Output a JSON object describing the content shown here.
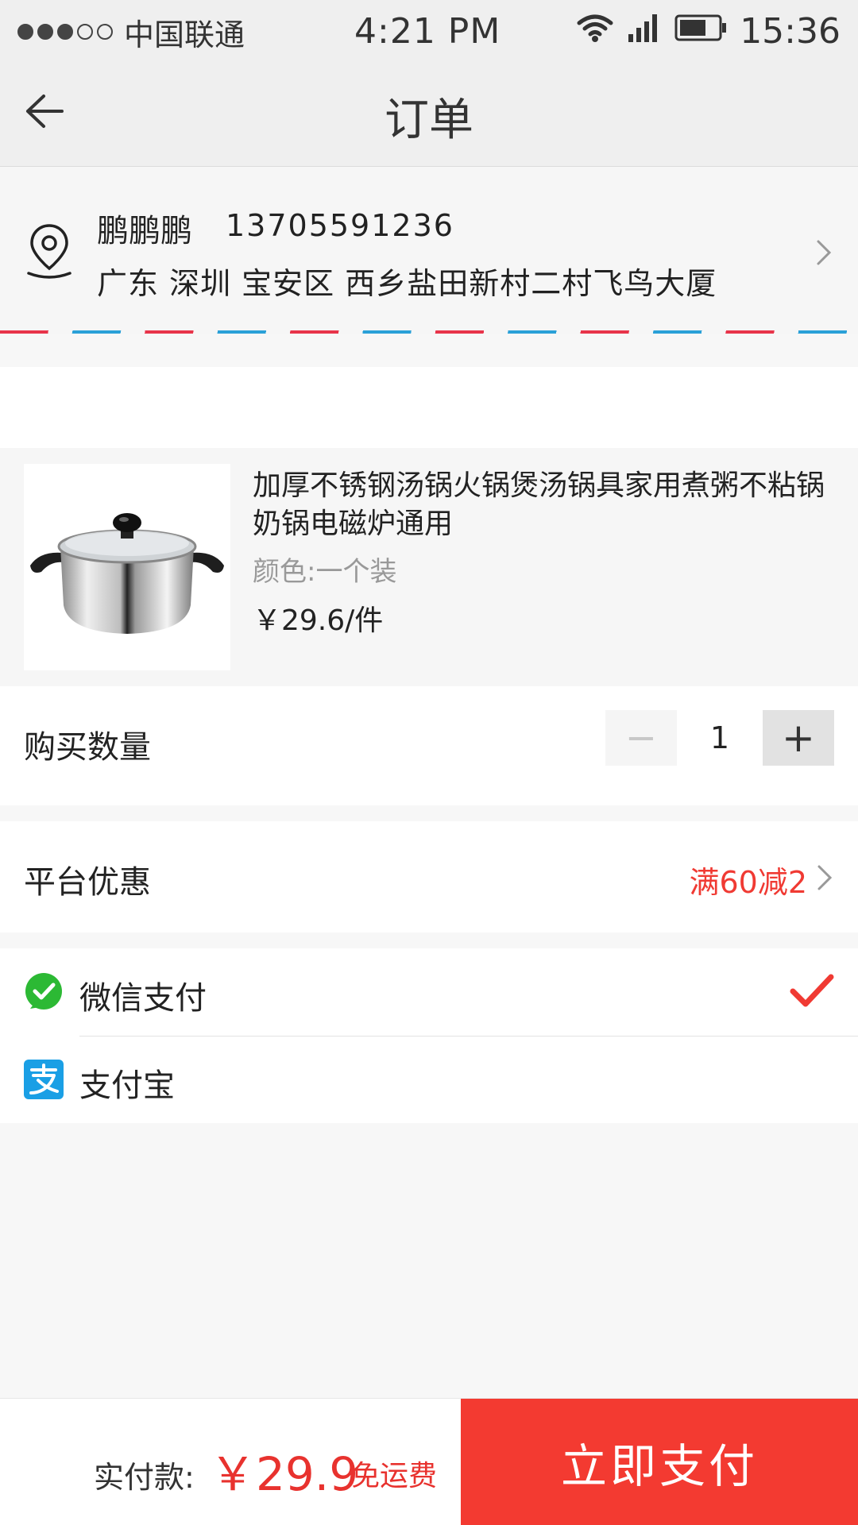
{
  "status_bar": {
    "carrier": "中国联通",
    "time": "4:21 PM",
    "clock": "15:36"
  },
  "nav": {
    "title": "订单"
  },
  "address": {
    "name": "鹏鹏鹏",
    "phone": "13705591236",
    "detail": "广东 深圳 宝安区 西乡盐田新村二村飞鸟大厦"
  },
  "product": {
    "title": "加厚不锈钢汤锅火锅煲汤锅具家用煮粥不粘锅奶锅电磁炉通用",
    "spec": "颜色:一个装",
    "price": "￥29.6/件"
  },
  "quantity": {
    "label": "购买数量",
    "minus": "−",
    "value": "1",
    "plus": "+"
  },
  "promo": {
    "label": "平台优惠",
    "value": "满60减2"
  },
  "payment": {
    "wechat_label": "微信支付",
    "alipay_label": "支付宝",
    "selected": "wechat"
  },
  "bottom": {
    "total_label": "实付款:",
    "total_price": "￥29.9",
    "shipping": "免运费",
    "pay_button": "立即支付"
  },
  "colors": {
    "accent": "#f33a31",
    "price_red": "#e8322e",
    "wechat_green": "#2cb934",
    "alipay_blue": "#1a9fe5"
  }
}
